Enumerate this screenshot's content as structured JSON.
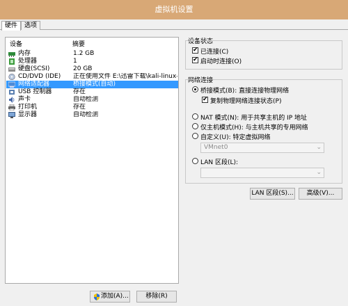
{
  "window": {
    "title": "虚拟机设置"
  },
  "tabs": [
    {
      "label": "硬件"
    },
    {
      "label": "选项"
    }
  ],
  "device_list": {
    "headers": {
      "device": "设备",
      "summary": "摘要"
    },
    "rows": [
      {
        "name": "内存",
        "summary": "1.2 GB",
        "icon": "memory-icon"
      },
      {
        "name": "处理器",
        "summary": "1",
        "icon": "cpu-icon"
      },
      {
        "name": "硬盘(SCSI)",
        "summary": "20 GB",
        "icon": "harddisk-icon"
      },
      {
        "name": "CD/DVD (IDE)",
        "summary": "正在使用文件 E:\\迅雷下载\\kali-linux-...",
        "icon": "cdrom-icon"
      },
      {
        "name": "网络适配器",
        "summary": "桥接模式(自动)",
        "icon": "network-icon",
        "selected": true
      },
      {
        "name": "USB 控制器",
        "summary": "存在",
        "icon": "usb-icon"
      },
      {
        "name": "声卡",
        "summary": "自动检测",
        "icon": "sound-icon"
      },
      {
        "name": "打印机",
        "summary": "存在",
        "icon": "printer-icon"
      },
      {
        "name": "显示器",
        "summary": "自动检测",
        "icon": "display-icon"
      }
    ]
  },
  "buttons": {
    "add": "添加(A)...",
    "remove": "移除(R)",
    "lan_segments": "LAN 区段(S)...",
    "advanced": "高级(V)..."
  },
  "device_status": {
    "title": "设备状态",
    "connected": {
      "label": "已连接(C)",
      "checked": true
    },
    "connect_on_power": {
      "label": "启动时连接(O)",
      "checked": true
    }
  },
  "network_connection": {
    "title": "网络连接",
    "bridged": {
      "label": "桥接模式(B): 直接连接物理网络",
      "selected": true
    },
    "replicate": {
      "label": "复制物理网络连接状态(P)",
      "checked": true
    },
    "nat": {
      "label": "NAT 模式(N): 用于共享主机的 IP 地址",
      "selected": false
    },
    "host_only": {
      "label": "仅主机模式(H): 与主机共享的专用网络",
      "selected": false
    },
    "custom": {
      "label": "自定义(U): 特定虚拟网络",
      "selected": false
    },
    "custom_select": "VMnet0",
    "lan_segment": {
      "label": "LAN 区段(L):",
      "selected": false
    },
    "lan_select": ""
  },
  "colors": {
    "titlebar": "#d8a876",
    "selection": "#3399ff",
    "background": "#f0f0f0"
  }
}
